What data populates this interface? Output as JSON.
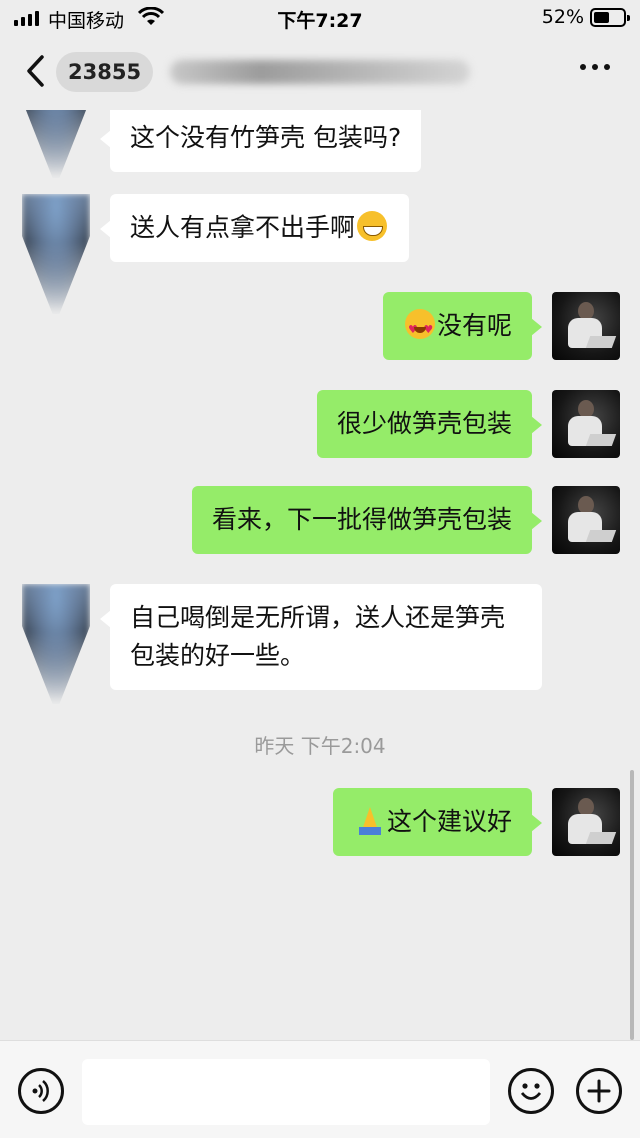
{
  "status_bar": {
    "carrier": "中国移动",
    "time": "下午7:27",
    "battery": "52%",
    "battery_level": 0.52
  },
  "nav": {
    "title": "23855"
  },
  "messages": [
    {
      "side": "in",
      "text": "这个没有竹笋壳 包装吗?",
      "emoji": null
    },
    {
      "side": "in",
      "text": "送人有点拿不出手啊",
      "emoji": "grin-icon"
    },
    {
      "side": "out",
      "text": "没有呢",
      "emoji": "heart-eyes-icon"
    },
    {
      "side": "out",
      "text": "很少做笋壳包装",
      "emoji": null
    },
    {
      "side": "out",
      "text": "看来，下一批得做笋壳包装",
      "emoji": null
    },
    {
      "side": "in",
      "text": "自己喝倒是无所谓，送人还是笋壳包装的好一些。",
      "emoji": null
    },
    {
      "side": "out",
      "text": "这个建议好",
      "emoji": "pray-icon"
    }
  ],
  "timestamp": "昨天 下午2:04",
  "input": {
    "value": ""
  }
}
